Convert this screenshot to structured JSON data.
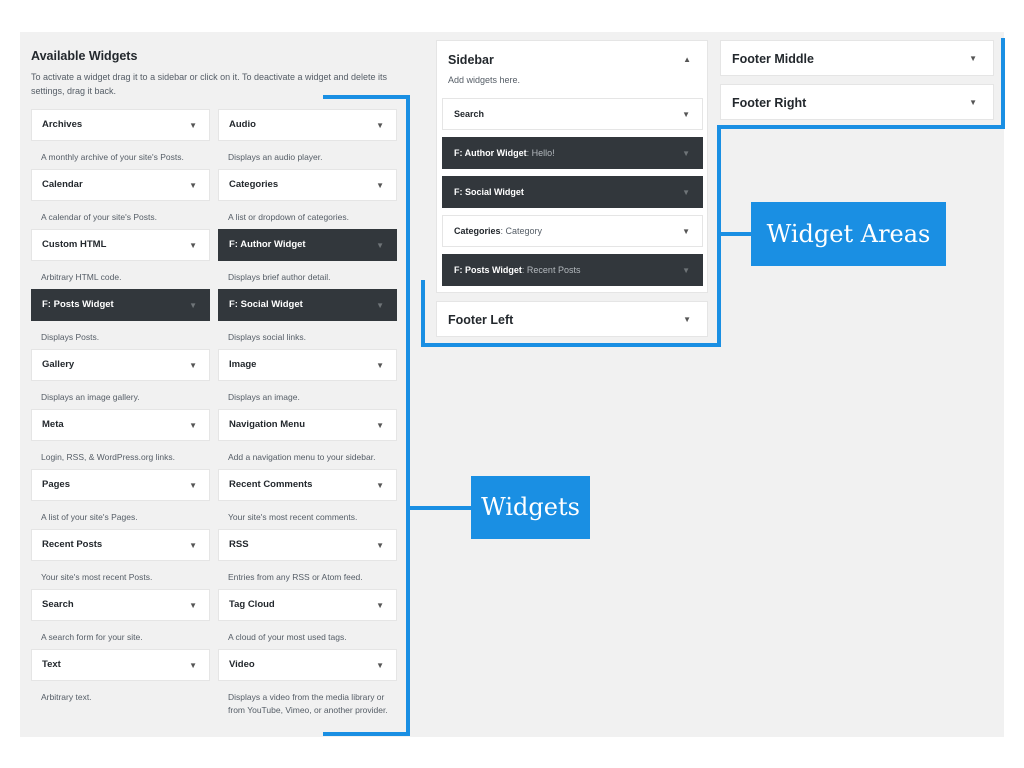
{
  "available": {
    "title": "Available Widgets",
    "description": "To activate a widget drag it to a sidebar or click on it. To deactivate a widget and delete its settings, drag it back."
  },
  "widgets": [
    {
      "title": "Archives",
      "desc": "A monthly archive of your site's Posts.",
      "dark": false
    },
    {
      "title": "Audio",
      "desc": "Displays an audio player.",
      "dark": false
    },
    {
      "title": "Calendar",
      "desc": "A calendar of your site's Posts.",
      "dark": false
    },
    {
      "title": "Categories",
      "desc": "A list or dropdown of categories.",
      "dark": false
    },
    {
      "title": "Custom HTML",
      "desc": "Arbitrary HTML code.",
      "dark": false
    },
    {
      "title": "F: Author Widget",
      "desc": "Displays brief author detail.",
      "dark": true
    },
    {
      "title": "F: Posts Widget",
      "desc": "Displays Posts.",
      "dark": true
    },
    {
      "title": "F: Social Widget",
      "desc": "Displays social links.",
      "dark": true
    },
    {
      "title": "Gallery",
      "desc": "Displays an image gallery.",
      "dark": false
    },
    {
      "title": "Image",
      "desc": "Displays an image.",
      "dark": false
    },
    {
      "title": "Meta",
      "desc": "Login, RSS, & WordPress.org links.",
      "dark": false
    },
    {
      "title": "Navigation Menu",
      "desc": "Add a navigation menu to your sidebar.",
      "dark": false
    },
    {
      "title": "Pages",
      "desc": "A list of your site's Pages.",
      "dark": false
    },
    {
      "title": "Recent Comments",
      "desc": "Your site's most recent comments.",
      "dark": false
    },
    {
      "title": "Recent Posts",
      "desc": "Your site's most recent Posts.",
      "dark": false
    },
    {
      "title": "RSS",
      "desc": "Entries from any RSS or Atom feed.",
      "dark": false
    },
    {
      "title": "Search",
      "desc": "A search form for your site.",
      "dark": false
    },
    {
      "title": "Tag Cloud",
      "desc": "A cloud of your most used tags.",
      "dark": false
    },
    {
      "title": "Text",
      "desc": "Arbitrary text.",
      "dark": false
    },
    {
      "title": "Video",
      "desc": "Displays a video from the media library or from YouTube, Vimeo, or another provider.",
      "dark": false
    }
  ],
  "sidebar": {
    "title": "Sidebar",
    "subtitle": "Add widgets here.",
    "items": [
      {
        "title": "Search",
        "sub": "",
        "dark": false
      },
      {
        "title": "F: Author Widget",
        "sub": ": Hello!",
        "dark": true
      },
      {
        "title": "F: Social Widget",
        "sub": "",
        "dark": true
      },
      {
        "title": "Categories",
        "sub": ": Category",
        "dark": false
      },
      {
        "title": "F: Posts Widget",
        "sub": ": Recent Posts",
        "dark": true
      }
    ]
  },
  "areas": {
    "footer_left": "Footer Left",
    "footer_middle": "Footer Middle",
    "footer_right": "Footer Right"
  },
  "icons": {
    "collapse": "triangle-up-icon",
    "expand": "triangle-down-icon"
  },
  "glyphs": {
    "up": "▲",
    "down": "▼"
  },
  "callouts": {
    "widgets": "Widgets",
    "widget_areas": "Widget Areas"
  },
  "colors": {
    "accent": "#1a8fe3",
    "dark_widget": "#32373c",
    "panel_bg": "#f1f1f1"
  }
}
